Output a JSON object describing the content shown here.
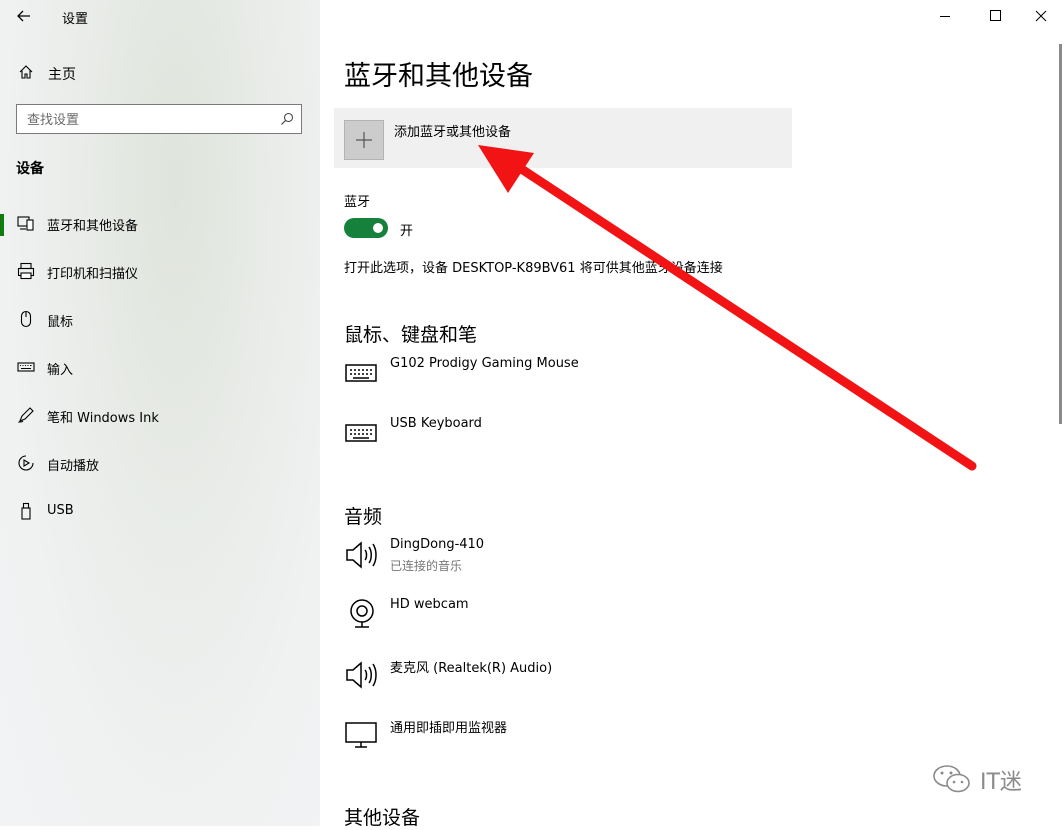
{
  "app": {
    "title": "设置"
  },
  "sidebar": {
    "home_label": "主页",
    "search_placeholder": "查找设置",
    "section": "设备",
    "items": [
      {
        "label": "蓝牙和其他设备",
        "icon": "bluetooth-devices-icon",
        "active": true
      },
      {
        "label": "打印机和扫描仪",
        "icon": "printer-icon"
      },
      {
        "label": "鼠标",
        "icon": "mouse-icon"
      },
      {
        "label": "输入",
        "icon": "keyboard-icon"
      },
      {
        "label": "笔和 Windows Ink",
        "icon": "pen-icon"
      },
      {
        "label": "自动播放",
        "icon": "autoplay-icon"
      },
      {
        "label": "USB",
        "icon": "usb-icon"
      }
    ]
  },
  "main": {
    "title": "蓝牙和其他设备",
    "add_device_label": "添加蓝牙或其他设备",
    "bluetooth": {
      "label": "蓝牙",
      "toggle_state": "开",
      "description": "打开此选项，设备 DESKTOP-K89BV61 将可供其他蓝牙设备连接"
    },
    "sections": {
      "input": "鼠标、键盘和笔",
      "audio": "音频",
      "other": "其他设备"
    },
    "input_devices": [
      {
        "name": "G102 Prodigy Gaming Mouse",
        "icon": "keyboard-device-icon"
      },
      {
        "name": "USB Keyboard",
        "icon": "keyboard-device-icon"
      }
    ],
    "audio_devices": [
      {
        "name": "DingDong-410",
        "status": "已连接的音乐",
        "icon": "speaker-icon"
      },
      {
        "name": "HD webcam",
        "icon": "webcam-icon"
      },
      {
        "name": "麦克风 (Realtek(R) Audio)",
        "icon": "speaker-icon"
      },
      {
        "name": "通用即插即用监视器",
        "icon": "monitor-icon"
      }
    ]
  },
  "watermark": {
    "text": "IT迷"
  },
  "colors": {
    "accent": "#107c10",
    "toggle_on": "#16813a",
    "arrow": "#f21414"
  }
}
